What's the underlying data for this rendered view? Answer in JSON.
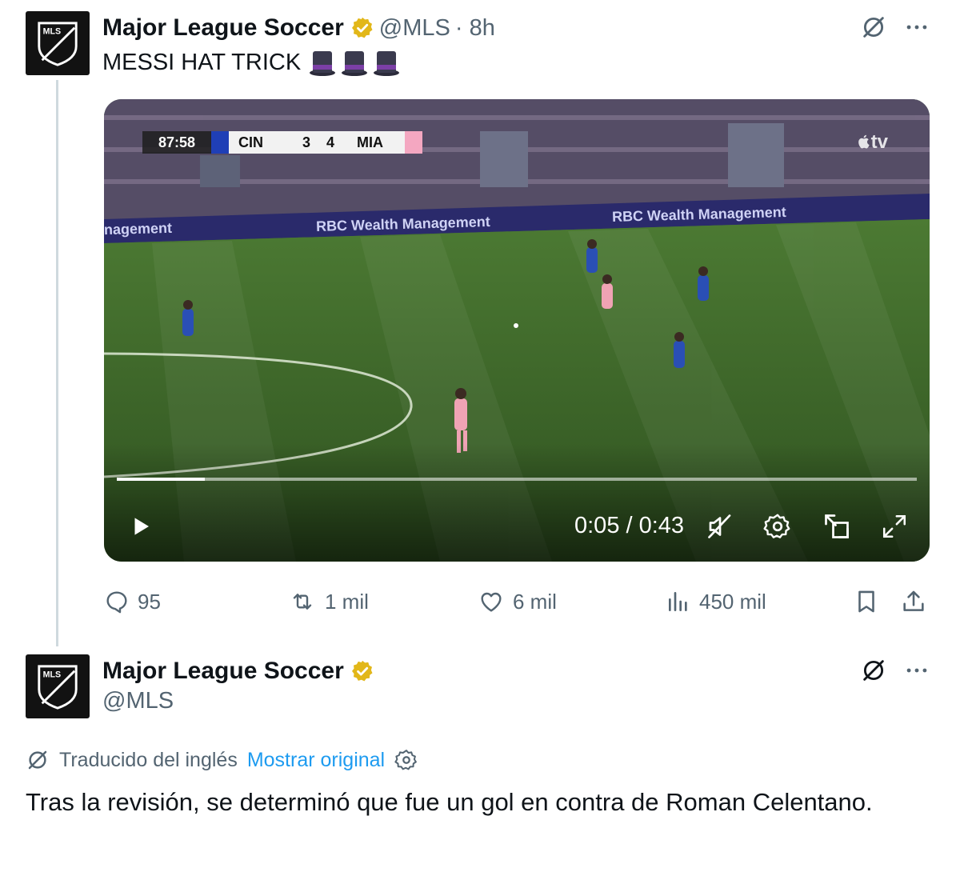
{
  "tweets": [
    {
      "author_name": "Major League Soccer",
      "handle": "@MLS",
      "time": "· 8h",
      "text": "MESSI HAT TRICK",
      "emoji": [
        "top-hat-emoji",
        "top-hat-emoji",
        "top-hat-emoji"
      ],
      "verified_color": "#e2b719"
    },
    {
      "author_name": "Major League Soccer",
      "handle": "@MLS",
      "translation_label": "Traducido del inglés",
      "show_original": "Mostrar original",
      "text": "Tras la revisión, se determinó que fue un gol en contra de Roman Celentano."
    }
  ],
  "video": {
    "scorebug": {
      "clock": "87:58",
      "home": "CIN",
      "home_score": "3",
      "away_score": "4",
      "away": "MIA"
    },
    "broadcaster_logo": "tv",
    "ad_board_text": "RBC Wealth Management",
    "ad_board_partial": "nagement",
    "time_display": "0:05 / 0:43",
    "progress_fraction": 0.11,
    "controls": [
      "play-icon",
      "mute-icon",
      "settings-icon",
      "picture-in-picture-icon",
      "fullscreen-icon"
    ]
  },
  "actions": {
    "replies": "95",
    "reposts": "1 mil",
    "likes": "6 mil",
    "views": "450 mil"
  },
  "colors": {
    "link": "#1d9bf0",
    "secondary_text": "#536471",
    "verified": "#e2b719",
    "pitch": "#3f6b2b"
  }
}
